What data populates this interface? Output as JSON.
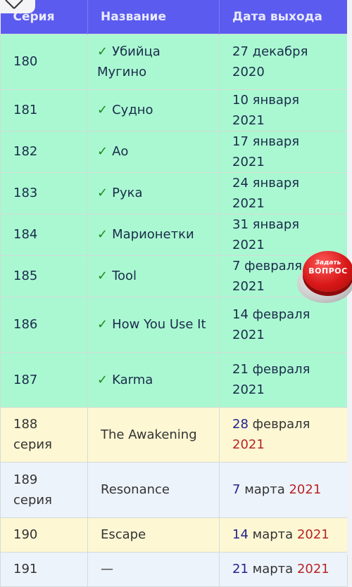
{
  "overlay": {
    "close_icon": "close-icon",
    "ask_button": {
      "line1": "Задать",
      "line2": "ВОПРОС"
    }
  },
  "table": {
    "headers": [
      "Серия",
      "Название",
      "Дата выхода"
    ],
    "colors": {
      "header_bg": "#5b5bef",
      "done_row_bg": "#aaf8d2",
      "yellow_row_bg": "#fdf7d4",
      "blue_row_bg": "#edf3fb",
      "check": "#1a8a1a",
      "day": "#22228e",
      "year": "#b82424"
    },
    "rows": [
      {
        "episode": "180",
        "check": "✓",
        "title": "Убийца Мугино",
        "date": "27 декабря 2020"
      },
      {
        "episode": "181",
        "check": "✓",
        "title": "Судно",
        "date": "10 января 2021"
      },
      {
        "episode": "182",
        "check": "✓",
        "title": "Ао",
        "date": "17 января 2021"
      },
      {
        "episode": "183",
        "check": "✓",
        "title": "Рука",
        "date": "24 января 2021"
      },
      {
        "episode": "184",
        "check": "✓",
        "title": "Марионетки",
        "date": "31 января 2021"
      },
      {
        "episode": "185",
        "check": "✓",
        "title": "Tool",
        "date": "7 февраля 2021"
      },
      {
        "episode": "186",
        "check": "✓",
        "title": "How You Use It",
        "date": "14 февраля 2021"
      },
      {
        "episode": "187",
        "check": "✓",
        "title": "Karma",
        "date": "21 февраля 2021"
      },
      {
        "episode": "188 серия",
        "title": "The Awakening",
        "day": "28",
        "month": "февраля",
        "year": "2021"
      },
      {
        "episode": "189 серия",
        "title": "Resonance",
        "day": "7",
        "month": "марта",
        "year": "2021"
      },
      {
        "episode": "190",
        "title": "Escape",
        "day": "14",
        "month": "марта",
        "year": "2021"
      },
      {
        "episode": "191",
        "title": "—",
        "day": "21",
        "month": "марта",
        "year": "2021"
      }
    ]
  }
}
